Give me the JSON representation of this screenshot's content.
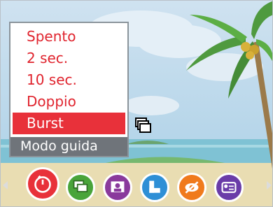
{
  "menu": {
    "title": "Modo guida",
    "items": [
      {
        "label": "Spento",
        "selected": false
      },
      {
        "label": "2 sec.",
        "selected": false
      },
      {
        "label": "10 sec.",
        "selected": false
      },
      {
        "label": "Doppio",
        "selected": false
      },
      {
        "label": "Burst",
        "selected": true
      }
    ]
  },
  "icons": [
    {
      "name": "self-timer-icon",
      "color": "#e8313a",
      "active": true
    },
    {
      "name": "drive-mode-icon",
      "color": "#49a43a",
      "active": false
    },
    {
      "name": "portrait-icon",
      "color": "#8a3a9c",
      "active": false
    },
    {
      "name": "image-size-icon",
      "color": "#2e8fd6",
      "active": false
    },
    {
      "name": "red-eye-icon",
      "color": "#f07a1c",
      "active": false
    },
    {
      "name": "info-icon",
      "color": "#6a3ca8",
      "active": false
    }
  ],
  "colors": {
    "accent": "#e8313a",
    "menu_text": "#e0242e",
    "title_bar": "#6f747a",
    "sky": "#bcd7ea",
    "sea": "#7fc2d4"
  }
}
